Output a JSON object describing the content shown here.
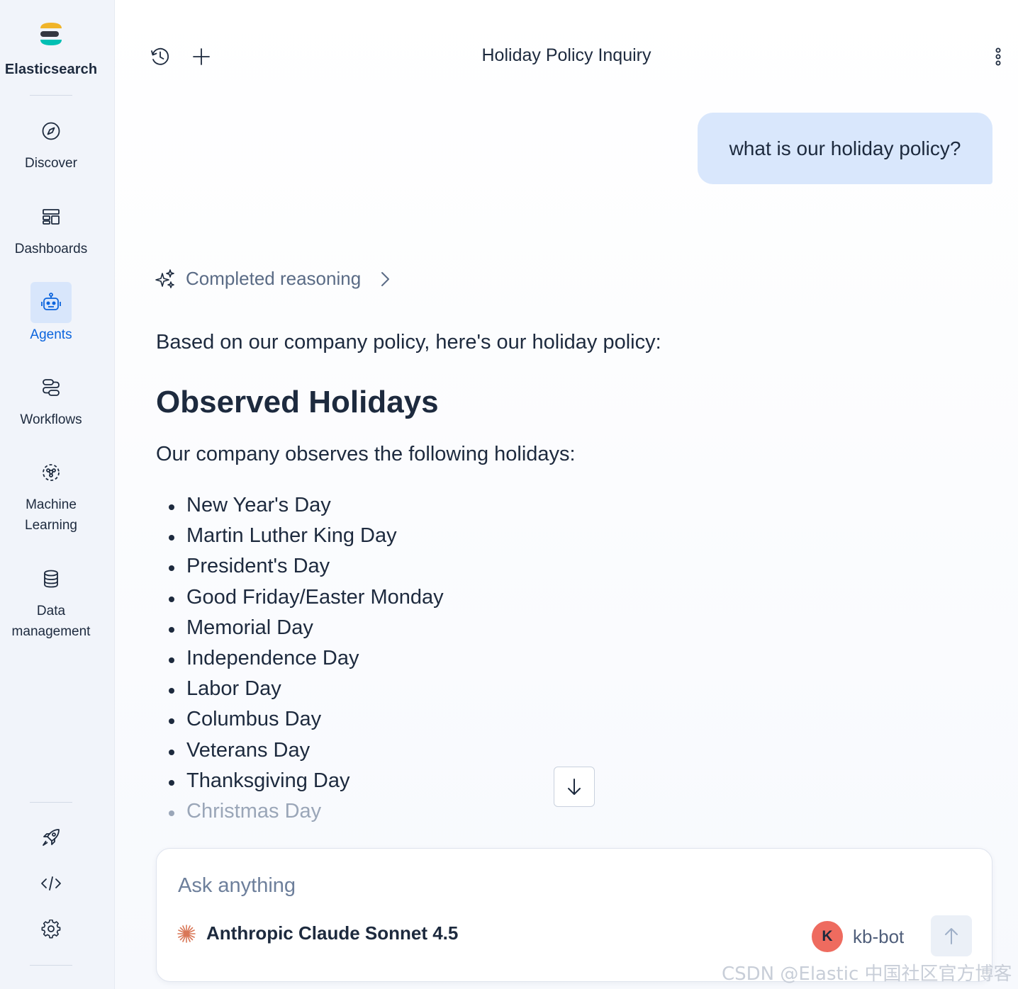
{
  "brand": {
    "name": "Elasticsearch"
  },
  "sidebar": {
    "items": [
      {
        "label": "Discover",
        "icon": "compass-icon"
      },
      {
        "label": "Dashboards",
        "icon": "dashboard-icon"
      },
      {
        "label": "Agents",
        "icon": "robot-icon",
        "active": true
      },
      {
        "label": "Workflows",
        "icon": "workflow-icon"
      },
      {
        "label": "Machine Learning",
        "icon": "machine-learning-icon"
      },
      {
        "label": "Data management",
        "icon": "database-icon"
      }
    ],
    "tools": [
      "rocket-icon",
      "code-icon",
      "gear-icon"
    ]
  },
  "header": {
    "title": "Holiday Policy Inquiry"
  },
  "conversation": {
    "user_message": "what is our holiday policy?",
    "reasoning_label": "Completed reasoning",
    "answer": {
      "intro": "Based on our company policy, here's our holiday policy:",
      "heading": "Observed Holidays",
      "subtext": "Our company observes the following holidays:",
      "holidays": [
        "New Year's Day",
        "Martin Luther King Day",
        "President's Day",
        "Good Friday/Easter Monday",
        "Memorial Day",
        "Independence Day",
        "Labor Day",
        "Columbus Day",
        "Veterans Day",
        "Thanksgiving Day",
        "Christmas Day"
      ]
    }
  },
  "composer": {
    "placeholder": "Ask anything",
    "model_name": "Anthropic Claude Sonnet 4.5",
    "agent_initial": "K",
    "agent_name": "kb-bot"
  },
  "watermark": "CSDN @Elastic 中国社区官方博客",
  "colors": {
    "accent": "#0b64dd",
    "user_bubble": "#d9e7fc",
    "avatar": "#ee6b5f",
    "anthropic": "#d97757"
  }
}
